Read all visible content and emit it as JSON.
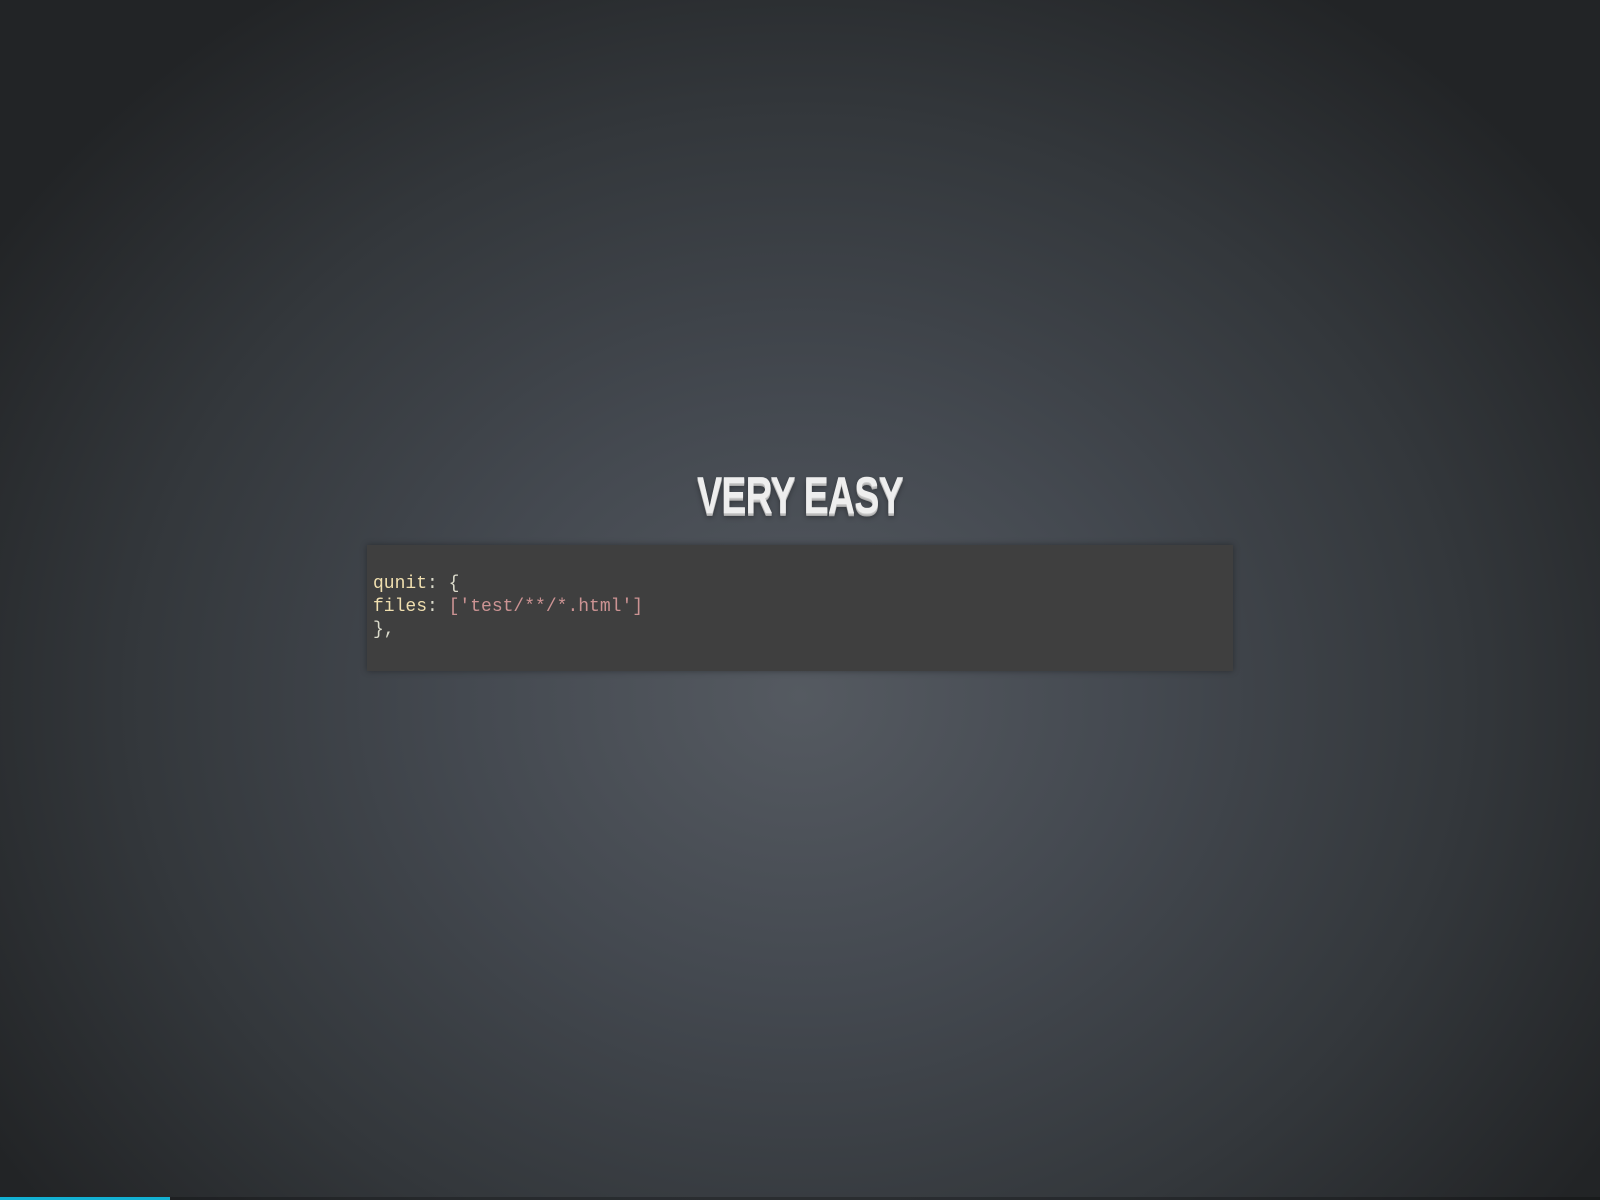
{
  "slide": {
    "title": "VERY EASY",
    "code": {
      "line1_key": "qunit",
      "line1_punct": ": {",
      "line2_key": "files",
      "line2_punct": ": ",
      "line2_value": "['test/**/*.html']",
      "line3": "},"
    }
  },
  "progress": {
    "fraction": 0.106,
    "color": "#13b1d3"
  }
}
